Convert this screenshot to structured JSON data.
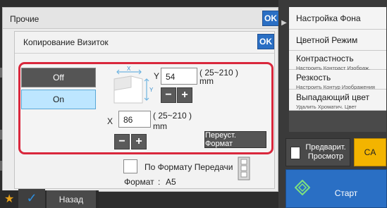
{
  "dialog": {
    "title": "Прочие",
    "ok_label": "OK"
  },
  "business_card_copy": {
    "title": "Копирование Визиток",
    "ok_label": "OK",
    "toggle": {
      "off_label": "Off",
      "on_label": "On",
      "selected": "On"
    },
    "y_axis": {
      "label": "Y",
      "value": "54",
      "range": "( 25~210 )",
      "unit": "mm"
    },
    "x_axis": {
      "label": "X",
      "value": "86",
      "range": "( 25~210 )",
      "unit": "mm"
    },
    "diagram_labels": {
      "x": "X",
      "y": "Y"
    },
    "stepper": {
      "minus": "−",
      "plus": "+"
    },
    "reset_format_label": "Переуст. Формат",
    "fit_to_send_label": "По Формату Передачи",
    "format_label": "Формат",
    "format_separator": ":",
    "format_value": "A5"
  },
  "right_menu": {
    "items": [
      {
        "label": "Настройка Фона",
        "sub": ""
      },
      {
        "label": "Цветной Режим",
        "sub": ""
      },
      {
        "label": "Контрастность",
        "sub": "Настроить Контраст Изображ."
      },
      {
        "label": "Резкость",
        "sub": "Настроить Контур Изображения"
      },
      {
        "label": "Выпадающий цвет",
        "sub": "Удалить Хроматич. Цвет"
      }
    ]
  },
  "actions": {
    "preview_label_line1": "Предварит.",
    "preview_label_line2": "Просмотр",
    "ca_label": "CA",
    "start_label": "Старт",
    "back_label": "Назад"
  },
  "icons": {
    "star": "star-icon",
    "check": "check-icon",
    "arrow": "expand-arrow-icon",
    "start": "start-diamond-icon",
    "preview": "preview-page-icon",
    "film": "film-strip-icon"
  },
  "colors": {
    "accent_blue": "#2a6fc4",
    "highlight_red": "#d9273c",
    "ca_yellow": "#f3b400",
    "selected_toggle": "#bde6ff"
  }
}
